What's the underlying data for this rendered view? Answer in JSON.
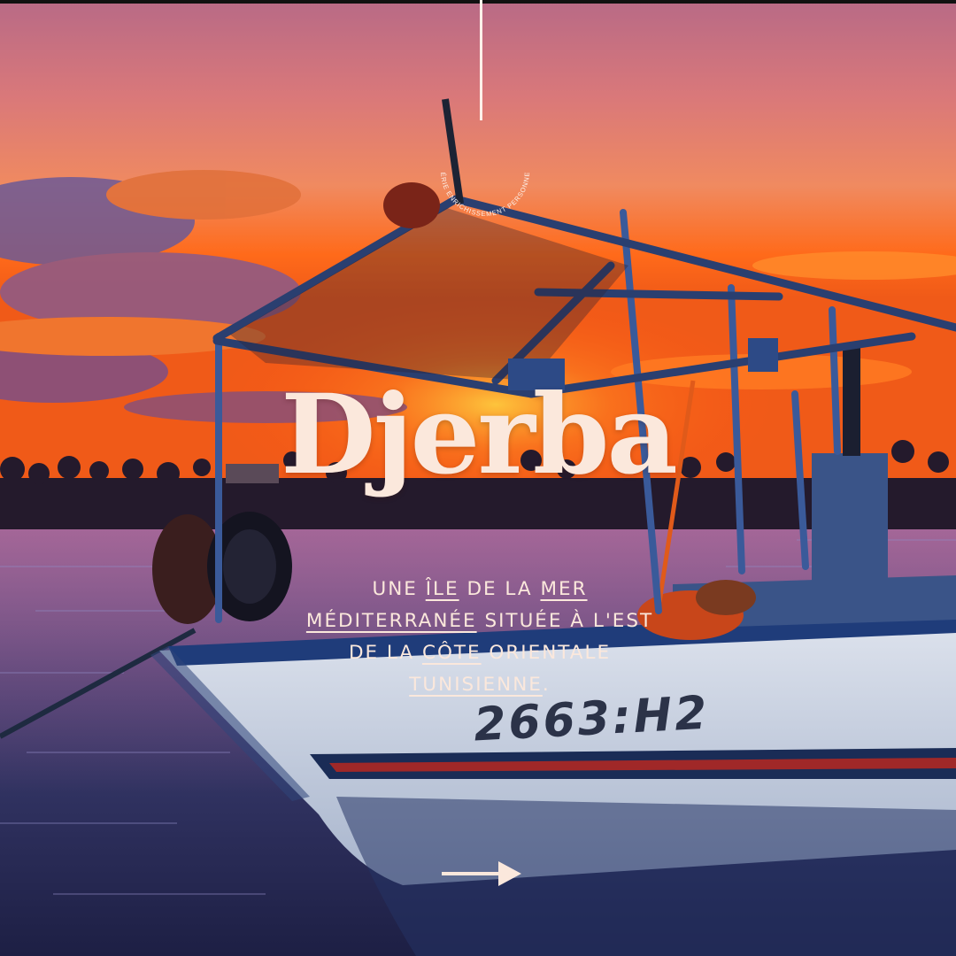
{
  "series_label": "SÉRIE ENRICHISSEMENT PERSONNEL",
  "title": "Djerba",
  "subtitle": {
    "parts": [
      {
        "text": "UNE ",
        "underline": false
      },
      {
        "text": "ÎLE",
        "underline": true
      },
      {
        "text": " DE LA ",
        "underline": false
      },
      {
        "text": "MER",
        "underline": true
      },
      {
        "text": " ",
        "underline": false
      },
      {
        "text": "MÉDITERRANÉE",
        "underline": true
      },
      {
        "text": " SITUÉE À L'EST DE LA ",
        "underline": false
      },
      {
        "text": "CÔTE",
        "underline": true
      },
      {
        "text": " ORIENTALE ",
        "underline": false
      },
      {
        "text": "TUNISIENNE",
        "underline": true
      },
      {
        "text": ".",
        "underline": false
      }
    ]
  },
  "boat_registration": "2663:H2",
  "icons": {
    "next": "arrow-right-icon"
  },
  "colors": {
    "text": "#fbe8dc",
    "sky_top": "#d0707a",
    "sky_glow": "#ff6a1a",
    "water": "#2c2f5e",
    "hull": "#cfd6e6"
  }
}
